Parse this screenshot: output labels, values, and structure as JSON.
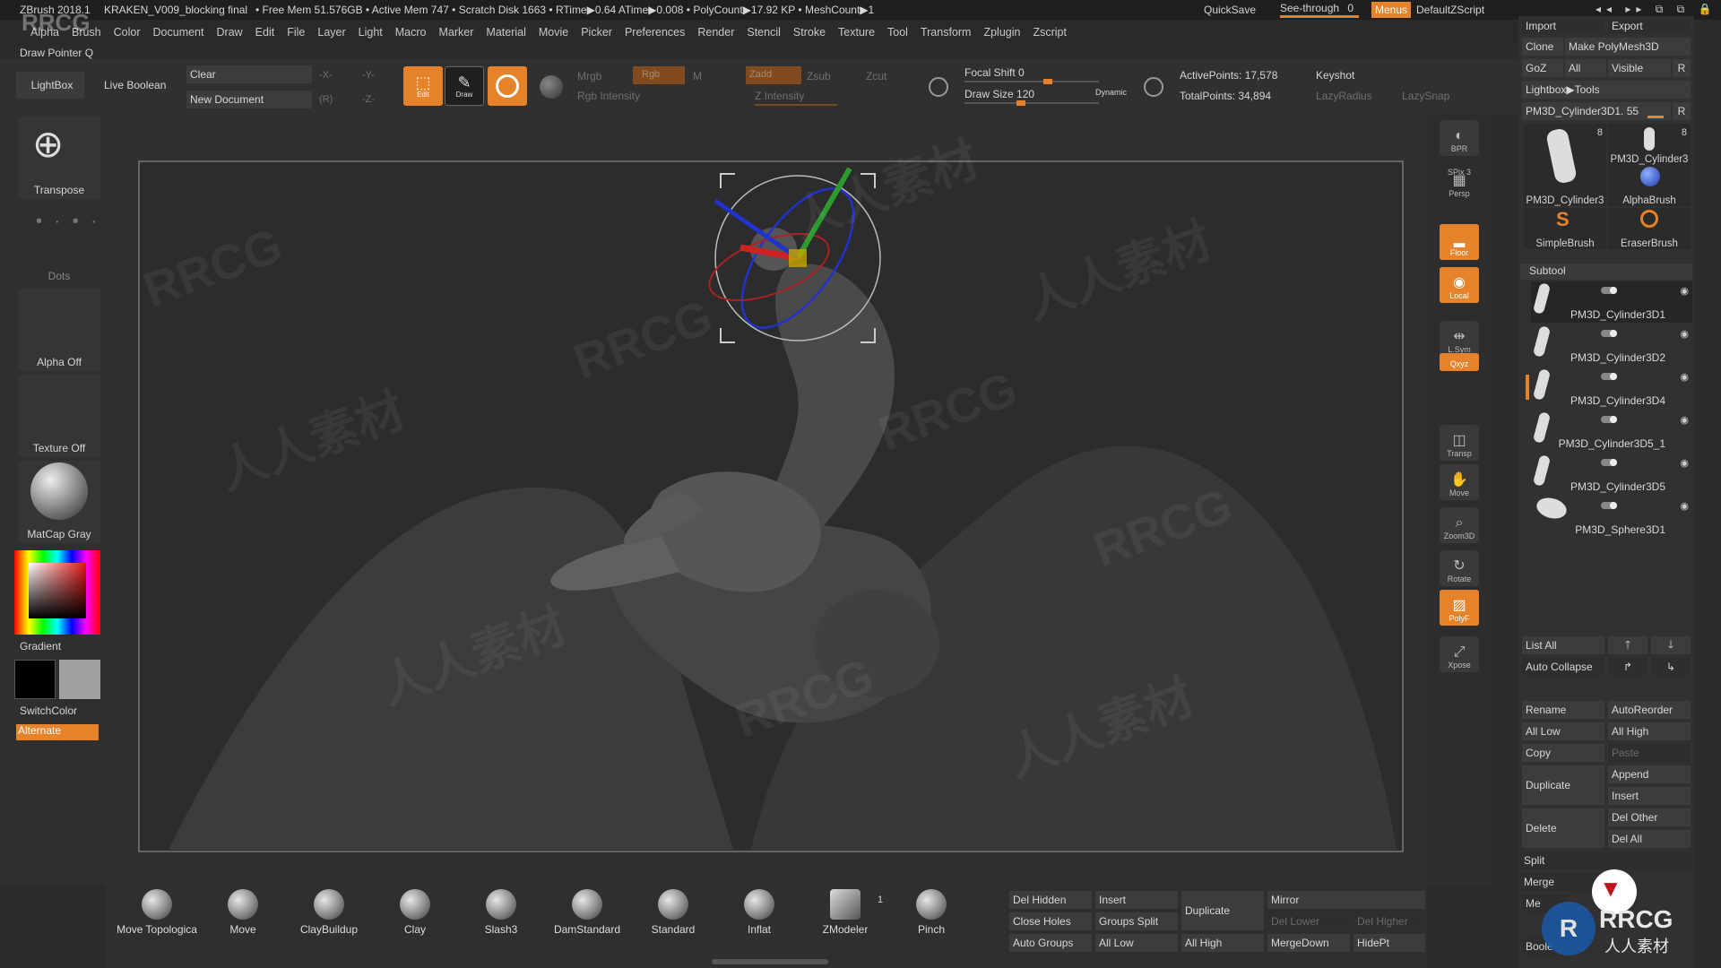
{
  "titlebar": {
    "app": "ZBrush 2018.1",
    "file": "KRAKEN_V009_blocking final",
    "stats": "• Free Mem 51.576GB • Active Mem 747 • Scratch Disk 1663 • RTime▶0.64 ATime▶0.008 • PolyCount▶17.92 KP • MeshCount▶1",
    "quicksave": "QuickSave",
    "see_through_label": "See-through",
    "see_through_value": "0",
    "menus": "Menus",
    "script": "DefaultZScript"
  },
  "menu_items": [
    "Alpha",
    "Brush",
    "Color",
    "Document",
    "Draw",
    "Edit",
    "File",
    "Layer",
    "Light",
    "Macro",
    "Marker",
    "Material",
    "Movie",
    "Picker",
    "Preferences",
    "Render",
    "Stencil",
    "Stroke",
    "Texture",
    "Tool",
    "Transform",
    "Zplugin",
    "Zscript"
  ],
  "draw_pointer": "Draw Pointer Q",
  "toolbar": {
    "lightbox": "LightBox",
    "live_boolean": "Live Boolean",
    "clear": "Clear",
    "new_document": "New Document",
    "x_minus": "-X-",
    "y_minus": "-Y-",
    "z_minus": "-Z-",
    "r": "(R)",
    "edit": "Edit",
    "draw": "Draw",
    "mrgb": "Mrgb",
    "rgb": "Rgb",
    "m": "M",
    "rgb_intensity": "Rgb Intensity",
    "zadd": "Zadd",
    "zsub": "Zsub",
    "zcut": "Zcut",
    "z_intensity": "Z Intensity",
    "focal_shift": "Focal Shift 0",
    "draw_size": "Draw Size 120",
    "dynamic": "Dynamic",
    "active_points": "ActivePoints: 17,578",
    "total_points": "TotalPoints: 34,894",
    "keyshot": "Keyshot",
    "lazy_radius": "LazyRadius",
    "lazy_snap": "LazySnap"
  },
  "left_shelf": {
    "transpose": "Transpose",
    "dots": "Dots",
    "alpha_off": "Alpha Off",
    "texture_off": "Texture Off",
    "matcap": "MatCap Gray",
    "gradient": "Gradient",
    "switch_color": "SwitchColor",
    "alternate": "Alternate"
  },
  "right_shelf": [
    {
      "name": "bpr",
      "label": "BPR",
      "on": false
    },
    {
      "name": "spix",
      "label": "SPix 3",
      "on": false
    },
    {
      "name": "persp",
      "label": "Persp",
      "on": false
    },
    {
      "name": "floor",
      "label": "Floor",
      "on": true
    },
    {
      "name": "local",
      "label": "Local",
      "on": true
    },
    {
      "name": "lsym",
      "label": "L.Sym",
      "on": false
    },
    {
      "name": "xyz",
      "label": "Qxyz",
      "on": true
    },
    {
      "name": "transp",
      "label": "Transp",
      "on": false
    },
    {
      "name": "move",
      "label": "Move",
      "on": false
    },
    {
      "name": "zoom3d",
      "label": "Zoom3D",
      "on": false
    },
    {
      "name": "rotate",
      "label": "Rotate",
      "on": false
    },
    {
      "name": "polyf",
      "label": "PolyF",
      "on": true
    },
    {
      "name": "xpose",
      "label": "Xpose",
      "on": false
    }
  ],
  "tool_panel": {
    "import": "Import",
    "export": "Export",
    "clone": "Clone",
    "make_polymesh": "Make PolyMesh3D",
    "goz": "GoZ",
    "all": "All",
    "visible": "Visible",
    "r": "R",
    "lightbox_tools": "Lightbox▶Tools",
    "current_tool": "PM3D_Cylinder3D1. 55",
    "thumb_count_1": "8",
    "thumb_count_2": "8",
    "thumb_1": "PM3D_Cylinder3",
    "thumb_2": "PM3D_Cylinder3",
    "thumb_3": "AlphaBrush",
    "thumb_4": "SimpleBrush",
    "thumb_5": "EraserBrush",
    "subtool_header": "Subtool",
    "subtools": [
      "PM3D_Cylinder3D1",
      "PM3D_Cylinder3D2",
      "PM3D_Cylinder3D4",
      "PM3D_Cylinder3D5_1",
      "PM3D_Cylinder3D5",
      "PM3D_Sphere3D1"
    ],
    "list_all": "List All",
    "auto_collapse": "Auto Collapse",
    "rename": "Rename",
    "auto_reorder": "AutoReorder",
    "all_low": "All Low",
    "all_high": "All High",
    "copy": "Copy",
    "paste": "Paste",
    "duplicate": "Duplicate",
    "append": "Append",
    "insert": "Insert",
    "delete": "Delete",
    "del_other": "Del Other",
    "del_all": "Del All",
    "split": "Split",
    "merge": "Merge",
    "me_trunc": "Me",
    "boole_trunc": "Boole"
  },
  "brushes": [
    {
      "label": "Move Topologica"
    },
    {
      "label": "Move"
    },
    {
      "label": "ClayBuildup"
    },
    {
      "label": "Clay"
    },
    {
      "label": "Slash3"
    },
    {
      "label": "DamStandard"
    },
    {
      "label": "Standard"
    },
    {
      "label": "Inflat"
    },
    {
      "label": "ZModeler"
    },
    {
      "label": "Pinch"
    }
  ],
  "zmodeler_count": "1",
  "bottom_buttons": {
    "del_hidden": "Del Hidden",
    "insert": "Insert",
    "duplicate": "Duplicate",
    "mirror": "Mirror",
    "close_holes": "Close Holes",
    "groups_split": "Groups Split",
    "del_lower": "Del Lower",
    "del_higher": "Del Higher",
    "auto_groups": "Auto Groups",
    "all_low": "All Low",
    "all_high": "All High",
    "merge_down": "MergeDown",
    "hide_pt": "HidePt"
  },
  "watermark": {
    "logo_top": "RRCG",
    "repeat": "RRCG",
    "cn": "人人素材",
    "corner_en": "RRCG",
    "corner_cn": "人人素材"
  },
  "colors": {
    "accent": "#e5822a",
    "bg": "#2b2b2b",
    "panel": "#353535"
  }
}
